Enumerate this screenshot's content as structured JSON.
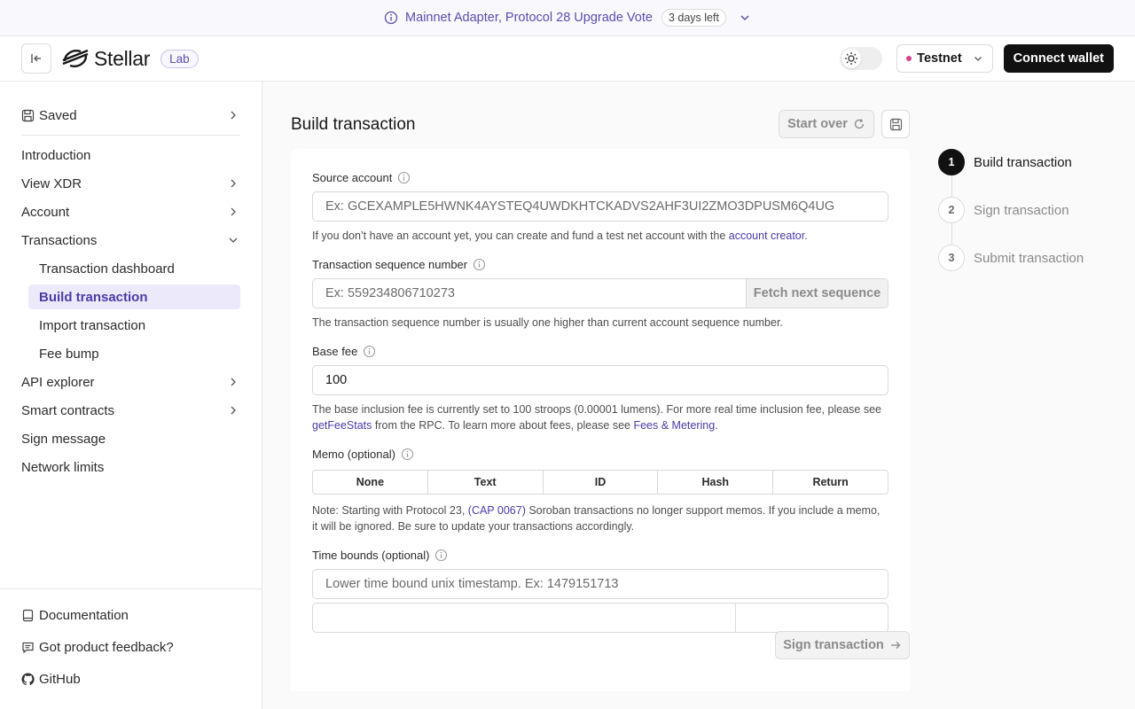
{
  "banner": {
    "text": "Mainnet Adapter, Protocol 28 Upgrade Vote",
    "badge": "3 days left"
  },
  "header": {
    "logo_text": "Stellar",
    "lab_label": "Lab",
    "network": "Testnet",
    "connect_label": "Connect wallet"
  },
  "sidebar": {
    "saved": "Saved",
    "items": [
      {
        "label": "Introduction"
      },
      {
        "label": "View XDR"
      },
      {
        "label": "Account"
      },
      {
        "label": "Transactions"
      },
      {
        "label": "Transaction dashboard"
      },
      {
        "label": "Build transaction"
      },
      {
        "label": "Import transaction"
      },
      {
        "label": "Fee bump"
      },
      {
        "label": "API explorer"
      },
      {
        "label": "Smart contracts"
      },
      {
        "label": "Sign message"
      },
      {
        "label": "Network limits"
      }
    ],
    "footer": {
      "documentation": "Documentation",
      "feedback": "Got product feedback?",
      "github": "GitHub"
    }
  },
  "main": {
    "title": "Build transaction",
    "start_over": "Start over",
    "source_account": {
      "label": "Source account",
      "placeholder": "Ex: GCEXAMPLE5HWNK4AYSTEQ4UWDKHTCKADVS2AHF3UI2ZMO3DPUSM6Q4UG",
      "note_prefix": "If you don’t have an account yet, you can create and fund a test net account with the ",
      "note_link": "account creator",
      "note_suffix": "."
    },
    "sequence": {
      "label": "Transaction sequence number",
      "placeholder": "Ex: 559234806710273",
      "fetch_label": "Fetch next sequence",
      "note": "The transaction sequence number is usually one higher than current account sequence number."
    },
    "base_fee": {
      "label": "Base fee",
      "value": "100",
      "note_part1": "The base inclusion fee is currently set to 100 stroops (0.00001 lumens). For more real time inclusion fee, please see ",
      "note_link1": "getFeeStats",
      "note_part2": " from the RPC. To learn more about fees, please see ",
      "note_link2": "Fees & Metering",
      "note_part3": "."
    },
    "memo": {
      "label": "Memo (optional)",
      "tabs": [
        "None",
        "Text",
        "ID",
        "Hash",
        "Return"
      ],
      "note_part1": "Note: Starting with Protocol 23, ",
      "note_link": "(CAP 0067)",
      "note_part2": " Soroban transactions no longer support memos. If you include a memo, it will be ignored. Be sure to update your transactions accordingly."
    },
    "time_bounds": {
      "label": "Time bounds (optional)",
      "placeholder": "Lower time bound unix timestamp. Ex: 1479151713"
    },
    "sign_label": "Sign transaction"
  },
  "steps": [
    {
      "num": "1",
      "label": "Build transaction"
    },
    {
      "num": "2",
      "label": "Sign transaction"
    },
    {
      "num": "3",
      "label": "Submit transaction"
    }
  ],
  "colors": {
    "accent": "#4a3ba8",
    "active_bg": "#ece9fb",
    "network_dot": "#d63f8c"
  }
}
